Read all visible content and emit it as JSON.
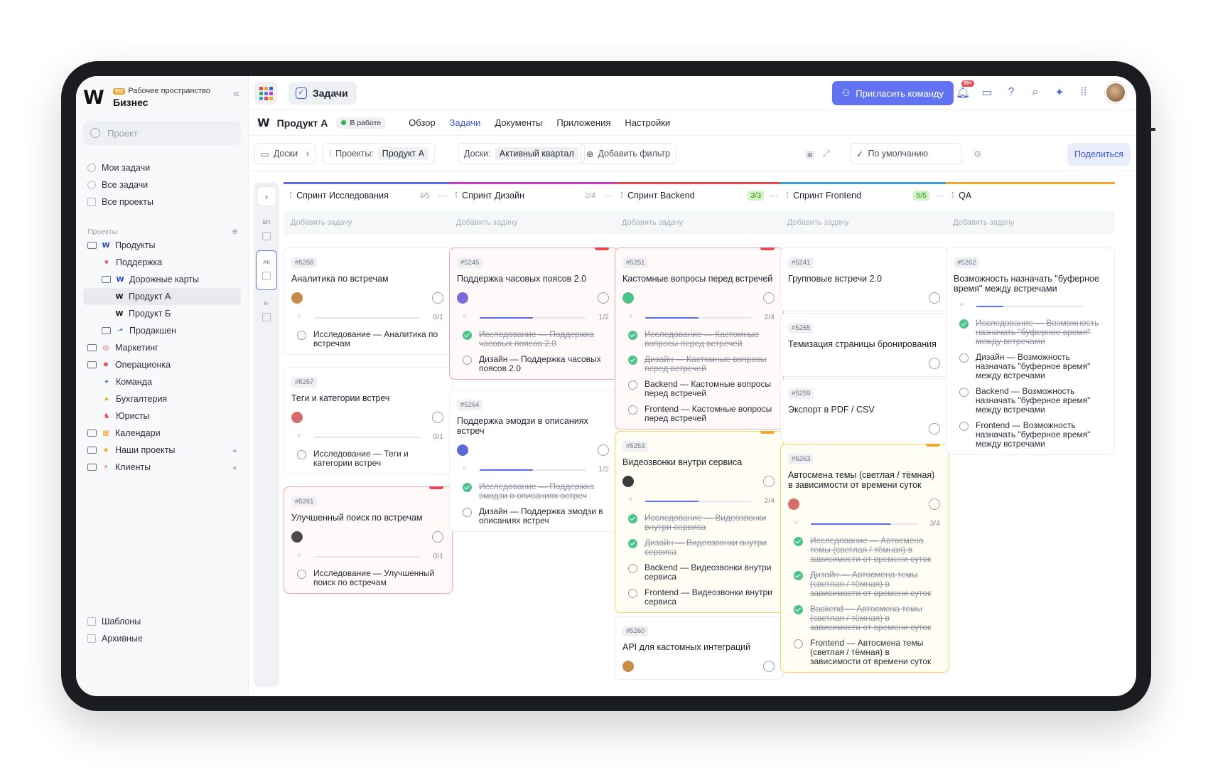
{
  "sidebar": {
    "workspace_label": "Рабочее пространство",
    "workspace_badge": "BIZ",
    "workspace_name": "Бизнес",
    "search_placeholder": "Проект",
    "nav": [
      "Мои задачи",
      "Все задачи",
      "Все проекты"
    ],
    "section_title": "Проекты",
    "tree": [
      {
        "label": "Продукты"
      },
      {
        "label": "Поддержка"
      },
      {
        "label": "Дорожные карты"
      },
      {
        "label": "Продукт А"
      },
      {
        "label": "Продукт Б"
      },
      {
        "label": "Продакшен"
      },
      {
        "label": "Маркетинг"
      },
      {
        "label": "Операционка"
      },
      {
        "label": "Команда"
      },
      {
        "label": "Бухгалтерия"
      },
      {
        "label": "Юристы"
      },
      {
        "label": "Календари"
      },
      {
        "label": "Наши проекты"
      },
      {
        "label": "Клиенты"
      }
    ],
    "bottom": [
      "Шаблоны",
      "Архивные"
    ]
  },
  "topbar": {
    "tab_title": "Задачи",
    "invite_label": "Пригласить команду",
    "notif_badge": "99+"
  },
  "project": {
    "name": "Продукт А",
    "status": "В работе",
    "tabs": [
      "Обзор",
      "Задачи",
      "Документы",
      "Приложения",
      "Настройки"
    ],
    "active_tab": "Задачи"
  },
  "filters": {
    "view": "Доски",
    "projects_label": "Проекты:",
    "projects_value": "Продукт А",
    "boards_label": "Доски:",
    "boards_value": "Активный квартал",
    "add_filter": "Добавить фильтр",
    "sort": "По умолчанию",
    "share": "Поделиться"
  },
  "strip": [
    "БП",
    "АК",
    "А-"
  ],
  "columns": [
    {
      "title": "Спринт Исследования",
      "count": "3/5",
      "color": "#5b6be8",
      "add": "Добавить задачу",
      "cards": [
        {
          "id": "#5258",
          "title": "Аналитика по встречам",
          "progress": "0/1",
          "subtasks": [
            {
              "t": "Исследование — Аналитика по встречам",
              "done": false
            }
          ]
        },
        {
          "id": "#5257",
          "title": "Теги и категории встреч",
          "progress": "0/1",
          "subtasks": [
            {
              "t": "Исследование — Теги и категории встреч",
              "done": false
            }
          ]
        },
        {
          "id": "#5261",
          "title": "Улучшенный поиск по встречам",
          "progress": "0/1",
          "subtasks": [
            {
              "t": "Исследование — Улучшенный поиск по встречам",
              "done": false
            }
          ]
        }
      ]
    },
    {
      "title": "Спринт Дизайн",
      "count": "2/4",
      "color": "#c93bc9",
      "add": "Добавить задачу",
      "cards": [
        {
          "id": "#5245",
          "title": "Поддержка часовых поясов 2.0",
          "progress": "1/2",
          "subtasks": [
            {
              "t": "Исследование — Поддержка часовых поясов 2.0",
              "done": true
            },
            {
              "t": "Дизайн — Поддержка часовых поясов 2.0",
              "done": false
            }
          ]
        },
        {
          "id": "#5264",
          "title": "Поддержка эмодзи в описаниях встреч",
          "progress": "1/2",
          "subtasks": [
            {
              "t": "Исследование — Поддержка эмодзи в описаниях встреч",
              "done": true
            },
            {
              "t": "Дизайн — Поддержка эмодзи в описаниях встреч",
              "done": false
            }
          ]
        }
      ]
    },
    {
      "title": "Спринт Backend",
      "count": "3/3",
      "color": "#e5484d",
      "add": "Добавить задачу",
      "cards": [
        {
          "id": "#5251",
          "title": "Кастомные вопросы перед встречей",
          "progress": "2/4",
          "subtasks": [
            {
              "t": "Исследование — Кастомные вопросы перед встречей",
              "done": true
            },
            {
              "t": "Дизайн — Кастомные вопросы перед встречей",
              "done": true
            },
            {
              "t": "Backend — Кастомные вопросы перед встречей",
              "done": false
            },
            {
              "t": "Frontend — Кастомные вопросы перед встречей",
              "done": false
            }
          ]
        },
        {
          "id": "#5253",
          "title": "Видеозвонки внутри сервиса",
          "progress": "2/4",
          "subtasks": [
            {
              "t": "Исследование — Видеозвонки внутри сервиса",
              "done": true
            },
            {
              "t": "Дизайн — Видеозвонки внутри сервиса",
              "done": true
            },
            {
              "t": "Backend — Видеозвонки внутри сервиса",
              "done": false
            },
            {
              "t": "Frontend — Видеозвонки внутри сервиса",
              "done": false
            }
          ]
        },
        {
          "id": "#5260",
          "title": "API для кастомных интеграций"
        }
      ]
    },
    {
      "title": "Спринт Frontend",
      "count": "5/5",
      "color": "#3b9ddb",
      "add": "Добавить задачу",
      "cards": [
        {
          "id": "#5241",
          "title": "Групповые встречи 2.0"
        },
        {
          "id": "#5255",
          "title": "Темизация страницы бронирования"
        },
        {
          "id": "#5259",
          "title": "Экспорт в PDF / CSV"
        },
        {
          "id": "#5263",
          "title": "Автосмена темы (светлая / тёмная) в зависимости от времени суток",
          "progress": "3/4",
          "subtasks": [
            {
              "t": "Исследование — Автосмена темы (светлая / тёмная) в зависимости от времени суток",
              "done": true
            },
            {
              "t": "Дизайн — Автосмена темы (светлая / тёмная) в зависимости от времени суток",
              "done": true
            },
            {
              "t": "Backend — Автосмена темы (светлая / тёмная) в зависимости от времени суток",
              "done": true
            },
            {
              "t": "Frontend — Автосмена темы (светлая / тёмная) в зависимости от времени суток",
              "done": false
            }
          ]
        }
      ]
    },
    {
      "title": "QA",
      "count": "",
      "color": "#f3a52b",
      "add": "Добавить задачу",
      "cards": [
        {
          "id": "#5262",
          "title": "Возможность назначать \"буферное время\" между встречами",
          "subtasks": [
            {
              "t": "Исследование — Возможность назначать \"буферное время\" между встречами",
              "done": true
            },
            {
              "t": "Дизайн — Возможность назначать \"буферное время\" между встречами",
              "done": false
            },
            {
              "t": "Backend — Возможность назначать \"буферное время\" между встречами",
              "done": false
            },
            {
              "t": "Frontend — Возможность назначать \"буферное время\" между встречами",
              "done": false
            }
          ]
        }
      ]
    }
  ]
}
